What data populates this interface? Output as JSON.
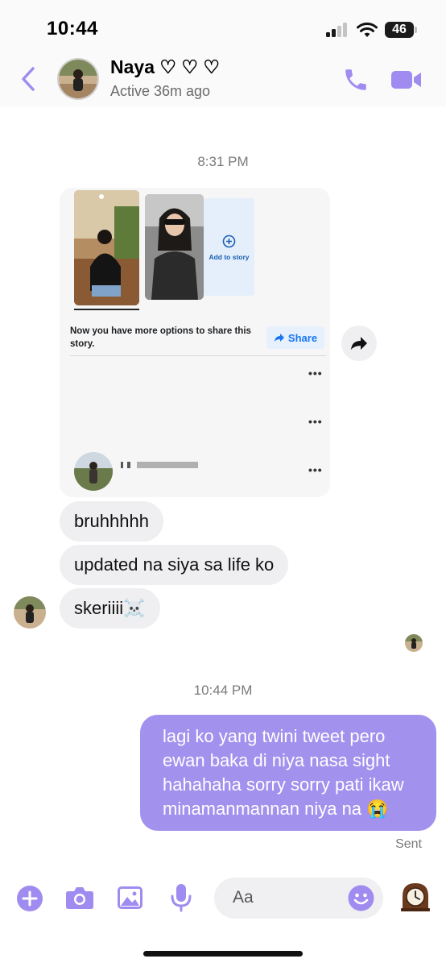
{
  "status_bar": {
    "time": "10:44",
    "network": "46"
  },
  "header": {
    "back_icon": "chevron-left-icon",
    "contact_name": "Naya ♡ ♡ ♡",
    "status": "Active 36m ago",
    "call_icon": "phone-icon",
    "video_icon": "video-camera-icon"
  },
  "timestamps": [
    "8:31 PM",
    "10:44 PM"
  ],
  "shared_card": {
    "add_to_story": "Add to story",
    "text": "Now you have more options to share this story.",
    "share_label": "Share",
    "forward_icon": "forward-arrow-icon"
  },
  "messages": {
    "incoming": [
      "bruhhhhh",
      "updated na siya sa life ko",
      "skeriiii☠️"
    ],
    "outgoing": "lagi ko yang twini tweet pero ewan baka di niya nasa sight hahahaha sorry sorry pati ikaw minamanmannan niya na 😭",
    "outgoing_status": "Sent"
  },
  "composer": {
    "placeholder": "Aa",
    "icons": [
      "plus-icon",
      "camera-icon",
      "gallery-icon",
      "microphone-icon",
      "emoji-icon",
      "clock-sticker-icon"
    ]
  },
  "colors": {
    "accent": "#a08cf0",
    "bubble_out": "#a391ee",
    "bubble_in": "#efeff1",
    "share_blue": "#1877f2"
  }
}
